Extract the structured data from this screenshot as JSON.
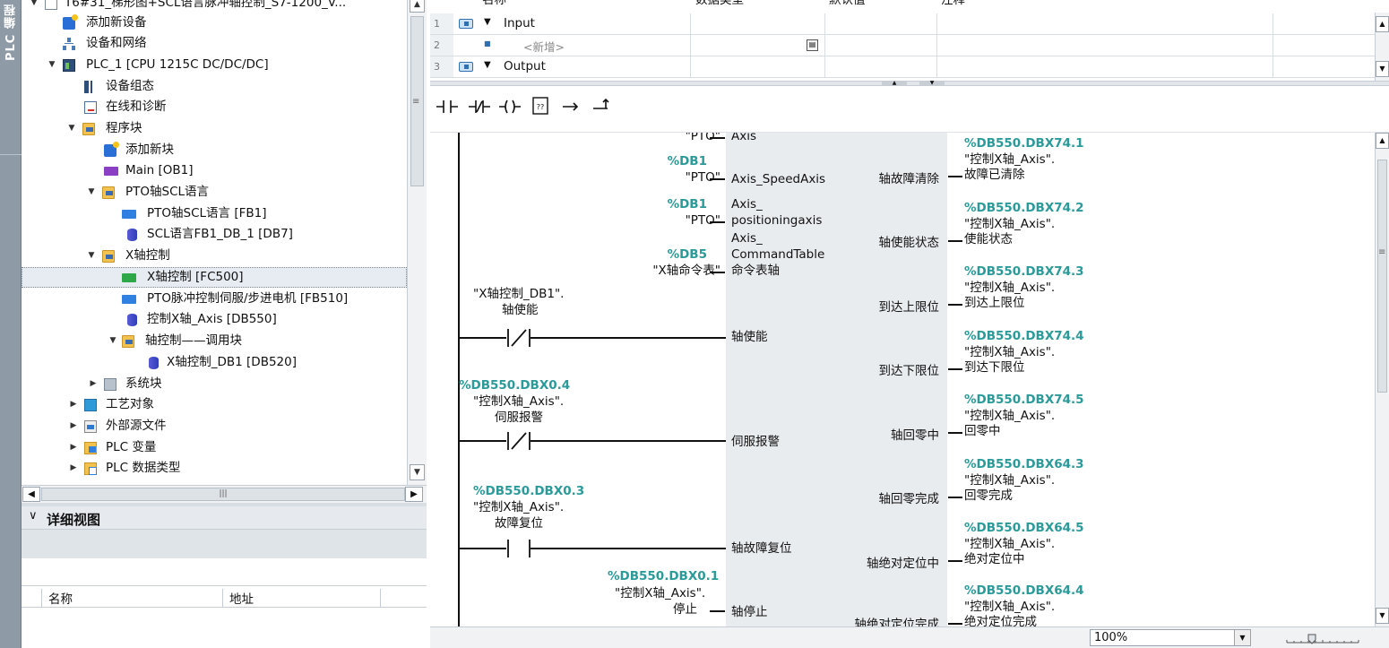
{
  "sidebar": {
    "vertical_tab": "PLC 编程"
  },
  "tree": {
    "project": "T6#31_梯形图+SCL语言脉冲轴控制_S7-1200_V...",
    "items": [
      {
        "label": "添加新设备",
        "icon": "add-device-icon"
      },
      {
        "label": "设备和网络",
        "icon": "network-icon"
      },
      {
        "label": "PLC_1 [CPU 1215C DC/DC/DC]",
        "icon": "plc-icon"
      },
      {
        "label": "设备组态",
        "icon": "device-config-icon"
      },
      {
        "label": "在线和诊断",
        "icon": "diagnostics-icon"
      },
      {
        "label": "程序块",
        "icon": "program-blocks-icon"
      },
      {
        "label": "添加新块",
        "icon": "add-block-icon"
      },
      {
        "label": "Main [OB1]",
        "icon": "ob-icon"
      },
      {
        "label": "PTO轴SCL语言",
        "icon": "group-folder-icon"
      },
      {
        "label": "PTO轴SCL语言 [FB1]",
        "icon": "fb-icon"
      },
      {
        "label": "SCL语言FB1_DB_1 [DB7]",
        "icon": "db-icon"
      },
      {
        "label": "X轴控制",
        "icon": "group-folder-icon"
      },
      {
        "label": "X轴控制 [FC500]",
        "icon": "fc-icon"
      },
      {
        "label": "PTO脉冲控制伺服/步进电机 [FB510]",
        "icon": "fb-icon"
      },
      {
        "label": "控制X轴_Axis [DB550]",
        "icon": "db-icon"
      },
      {
        "label": "轴控制——调用块",
        "icon": "group-folder-icon"
      },
      {
        "label": "X轴控制_DB1 [DB520]",
        "icon": "db-icon"
      },
      {
        "label": "系统块",
        "icon": "system-blocks-icon"
      },
      {
        "label": "工艺对象",
        "icon": "technology-objects-icon"
      },
      {
        "label": "外部源文件",
        "icon": "external-sources-icon"
      },
      {
        "label": "PLC 变量",
        "icon": "plc-tags-icon"
      },
      {
        "label": "PLC 数据类型",
        "icon": "plc-datatypes-icon"
      }
    ]
  },
  "details": {
    "title": "详细视图",
    "col_name": "名称",
    "col_address": "地址"
  },
  "interface": {
    "headers": {
      "name": "名称",
      "datatype": "数据类型",
      "default": "默认值",
      "comment": "注释"
    },
    "rows": [
      {
        "num": "1",
        "label": "Input"
      },
      {
        "num": "2",
        "label": "<新增>"
      },
      {
        "num": "3",
        "label": "Output"
      }
    ]
  },
  "ladder": {
    "left": {
      "pto_top": "\"PTO\"",
      "db1_a": "%DB1",
      "pto_a": "\"PTO\"",
      "db1_b": "%DB1",
      "pto_b": "\"PTO\"",
      "db5": "%DB5",
      "cmdtable": "\"X轴命令表\"",
      "enable_tag1": "\"X轴控制_DB1\".",
      "enable_tag2": "轴使能",
      "servo_op": "%DB550.DBX0.4",
      "servo_tag1": "\"控制X轴_Axis\".",
      "servo_tag2": "伺服报警",
      "reset_op": "%DB550.DBX0.3",
      "reset_tag1": "\"控制X轴_Axis\".",
      "reset_tag2": "故障复位",
      "stop_op": "%DB550.DBX0.1",
      "stop_tag1": "\"控制X轴_Axis\".",
      "stop_tag2": "停止"
    },
    "inputs": {
      "axis": "Axis",
      "speedaxis": "Axis_SpeedAxis",
      "pos1": "Axis_",
      "pos2": "positioningaxis",
      "cmd1": "Axis_",
      "cmd2": "CommandTable",
      "cmd3": "命令表轴",
      "enable": "轴使能",
      "servo": "伺服报警",
      "reset": "轴故障复位",
      "stop": "轴停止"
    },
    "outputs": {
      "o1": "轴故障清除",
      "o2": "轴使能状态",
      "o3": "到达上限位",
      "o4": "到达下限位",
      "o5": "轴回零中",
      "o6": "轴回零完成",
      "o7": "轴绝对定位中",
      "o8": "轴绝对定位完成"
    },
    "out_tags": {
      "a1": "%DB550.DBX74.1",
      "b1": "\"控制X轴_Axis\".",
      "c1": "故障已清除",
      "a2": "%DB550.DBX74.2",
      "b2": "\"控制X轴_Axis\".",
      "c2": "使能状态",
      "a3": "%DB550.DBX74.3",
      "b3": "\"控制X轴_Axis\".",
      "c3": "到达上限位",
      "a4": "%DB550.DBX74.4",
      "b4": "\"控制X轴_Axis\".",
      "c4": "到达下限位",
      "a5": "%DB550.DBX74.5",
      "b5": "\"控制X轴_Axis\".",
      "c5": "回零中",
      "a6": "%DB550.DBX64.3",
      "b6": "\"控制X轴_Axis\".",
      "c6": "回零完成",
      "a7": "%DB550.DBX64.5",
      "b7": "\"控制X轴_Axis\".",
      "c7": "绝对定位中",
      "a8": "%DB550.DBX64.4",
      "b8": "\"控制X轴_Axis\".",
      "c8": "绝对定位完成"
    }
  },
  "status": {
    "zoom": "100%"
  },
  "colors": {
    "operand": "#2a9a9a",
    "selection": "#e7ecf2",
    "block_fill": "#e9ecef"
  }
}
